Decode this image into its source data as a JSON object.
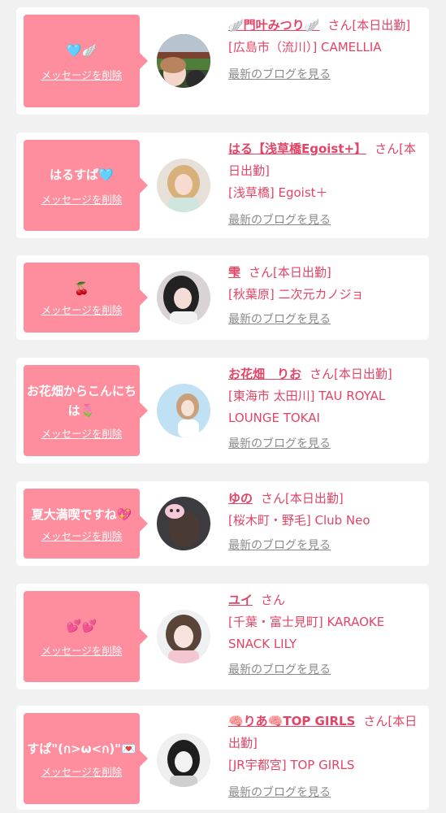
{
  "delete_label": "メッセージを削除",
  "blog_label": "最新のブログを見る",
  "colors": {
    "page_bg": "#f1f1f1",
    "card_bg": "#ffffff",
    "bubble": "#fe8e9e",
    "accent_text": "#e34466",
    "link_gray": "#8a8a8a"
  },
  "cards": [
    {
      "message": "🩵🪽",
      "name": "🪽門叶みつり🪽",
      "suffix": "さん[本日出勤]",
      "shop": "[広島市（流川）] CAMELLIA",
      "avatar_icon": "stadium-selfie-avatar"
    },
    {
      "message": "はるすぱ🩵",
      "name": "はる【浅草橋Egoist+】",
      "suffix": "さん[本日出勤]",
      "shop": "[浅草橋] Egoist＋",
      "avatar_icon": "blonde-girl-avatar"
    },
    {
      "message": "🍒",
      "name": "雫",
      "suffix": "さん[本日出勤]",
      "shop": "[秋葉原] 二次元カノジョ",
      "avatar_icon": "dark-hair-girl-avatar"
    },
    {
      "message": "お花畑からこんにちは🌷",
      "name": "お花畑　りお",
      "suffix": "さん[本日出勤]",
      "shop": "[東海市 太田川] TAU ROYAL LOUNGE TOKAI",
      "avatar_icon": "light-background-girl-avatar"
    },
    {
      "message": "夏大満喫ですね💖",
      "name": "ゆの",
      "suffix": "さん[本日出勤]",
      "shop": "[桜木町・野毛] Club Neo",
      "avatar_icon": "bunny-sticker-avatar"
    },
    {
      "message": "💕💕",
      "name": "ユイ",
      "suffix": "さん",
      "shop": "[千葉・富士見町] KARAOKE SNACK LILY",
      "avatar_icon": "peace-sign-girl-avatar"
    },
    {
      "message": "すぱ\"(ก>ω<ก)\"💌",
      "name": "🧠りあ🧠TOP GIRLS",
      "suffix": "さん[本日出勤]",
      "shop": "[JR宇都宮] TOP GIRLS",
      "avatar_icon": "monochrome-girl-avatar"
    }
  ]
}
